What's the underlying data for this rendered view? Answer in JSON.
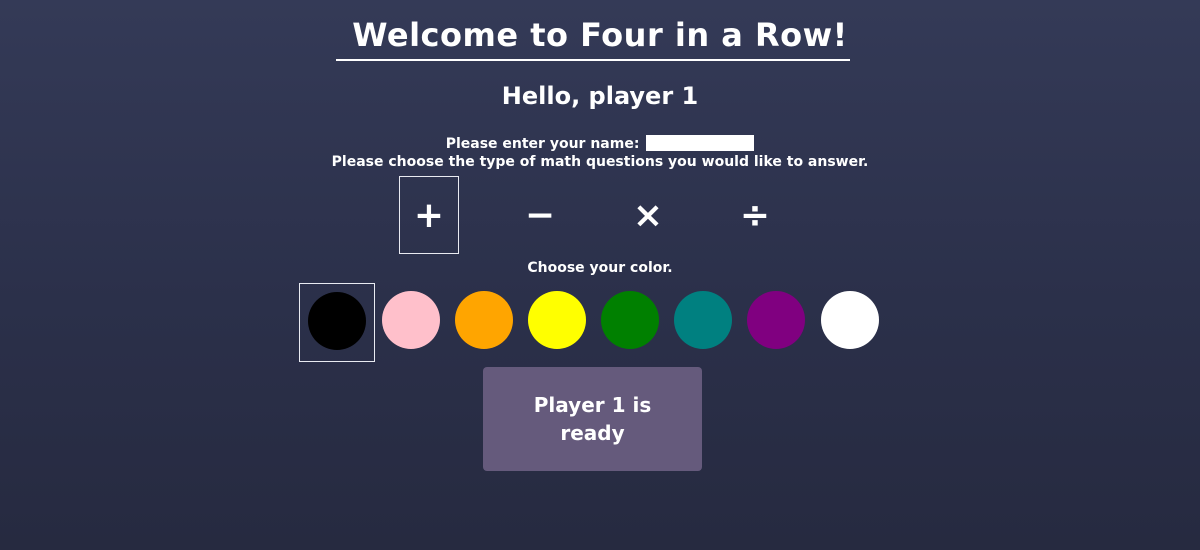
{
  "header": {
    "title": "Welcome to Four in a Row!",
    "greeting": "Hello, player 1"
  },
  "name_field": {
    "label": "Please enter your name:",
    "value": "",
    "placeholder": ""
  },
  "math": {
    "prompt": "Please choose the type of math questions you would like to answer.",
    "options": [
      {
        "symbol": "+",
        "icon": "plus-icon",
        "selected": true
      },
      {
        "symbol": "−",
        "icon": "minus-icon",
        "selected": false
      },
      {
        "symbol": "×",
        "icon": "multiply-icon",
        "selected": false
      },
      {
        "symbol": "÷",
        "icon": "divide-icon",
        "selected": false
      }
    ]
  },
  "colors": {
    "prompt": "Choose your color.",
    "options": [
      {
        "name": "black",
        "hex": "#000000",
        "selected": true
      },
      {
        "name": "pink",
        "hex": "#ffc0cb",
        "selected": false
      },
      {
        "name": "orange",
        "hex": "#ffa500",
        "selected": false
      },
      {
        "name": "yellow",
        "hex": "#ffff00",
        "selected": false
      },
      {
        "name": "green",
        "hex": "#008000",
        "selected": false
      },
      {
        "name": "teal",
        "hex": "#008080",
        "selected": false
      },
      {
        "name": "purple",
        "hex": "#800080",
        "selected": false
      },
      {
        "name": "white",
        "hex": "#ffffff",
        "selected": false
      }
    ]
  },
  "ready_button": {
    "label": "Player 1 is ready",
    "color": "#655a7c"
  }
}
